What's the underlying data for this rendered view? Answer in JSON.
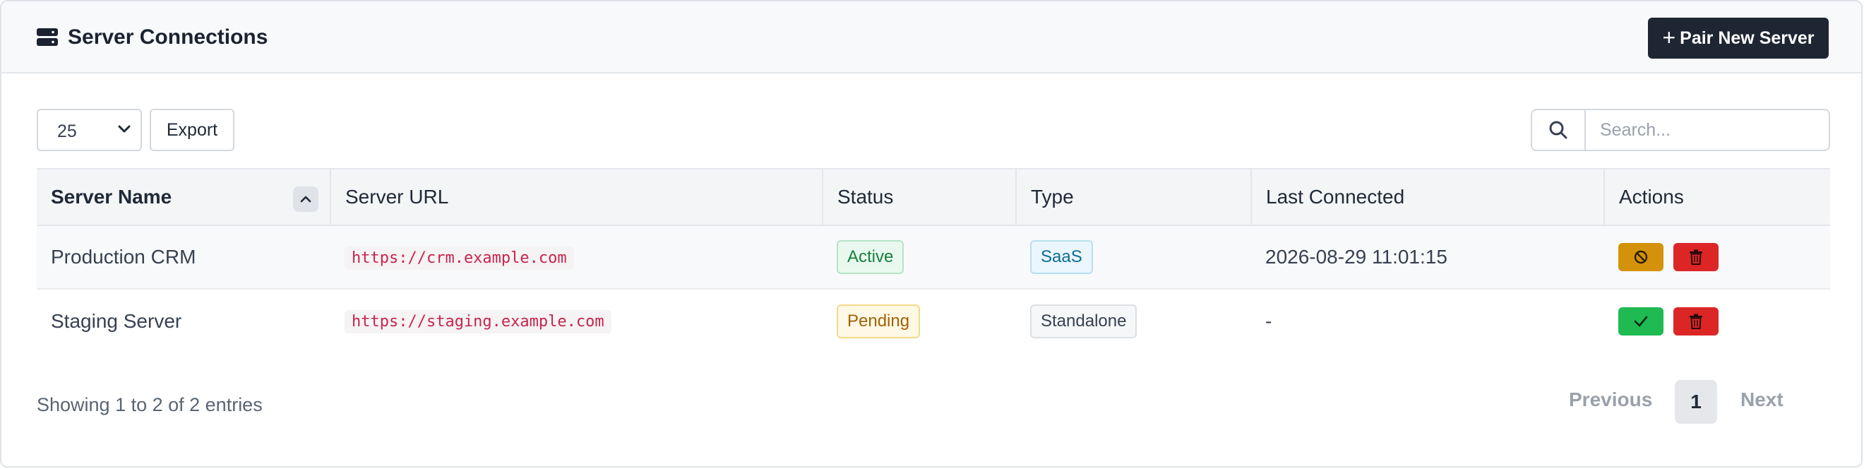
{
  "header": {
    "title": "Server Connections",
    "icon": "server-icon",
    "pair_button": {
      "icon": "plus-icon",
      "label": "Pair New Server"
    }
  },
  "toolbar": {
    "page_size": "25",
    "export_label": "Export",
    "search": {
      "icon": "search-icon",
      "placeholder": "Search...",
      "value": ""
    }
  },
  "table": {
    "columns": [
      "Server Name",
      "Server URL",
      "Status",
      "Type",
      "Last Connected",
      "Actions"
    ],
    "sorted_column": "Server Name",
    "sort_direction": "ascending",
    "rows": [
      {
        "name": "Production CRM",
        "url": "https://crm.example.com",
        "status": "Active",
        "type": "SaaS",
        "last_connected": "2026-08-29 11:01:15",
        "actions": [
          "deactivate",
          "delete"
        ]
      },
      {
        "name": "Staging Server",
        "url": "https://staging.example.com",
        "status": "Pending",
        "type": "Standalone",
        "last_connected": "-",
        "actions": [
          "approve",
          "delete"
        ]
      }
    ]
  },
  "footer": {
    "info": "Showing 1 to 2 of 2 entries",
    "previous": "Previous",
    "current_page": "1",
    "next": "Next"
  },
  "colors": {
    "primary_button": "#1e2633",
    "active": "#15803d",
    "pending": "#a16207",
    "saas": "#0e6c94",
    "warning_button": "#d4920a",
    "success_button": "#1fba52",
    "danger_button": "#dc2626"
  }
}
